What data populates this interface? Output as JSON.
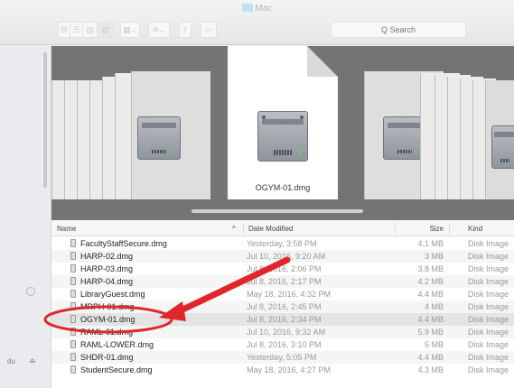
{
  "window": {
    "title": "Mac"
  },
  "toolbar": {
    "search_placeholder": "Q Search",
    "view_buttons": [
      "icon-view-icon",
      "list-view-icon",
      "column-view-icon",
      "coverflow-view-icon"
    ],
    "arrange_icon": "arrange-icon",
    "action_icon": "gear-icon",
    "share_icon": "share-icon",
    "tag_icon": "tag-icon"
  },
  "sidebar": {
    "partial_text": "du"
  },
  "coverflow": {
    "selected_label": "OGYM-01.dmg"
  },
  "columns": {
    "name": "Name",
    "date": "Date Modified",
    "size": "Size",
    "kind": "Kind",
    "sort_indicator": "^"
  },
  "files": [
    {
      "name": "FacultyStaffSecure.dmg",
      "date": "Yesterday, 3:58 PM",
      "size": "4.1 MB",
      "kind": "Disk Image"
    },
    {
      "name": "HARP-02.dmg",
      "date": "Jul 10, 2016, 9:20 AM",
      "size": "3 MB",
      "kind": "Disk Image"
    },
    {
      "name": "HARP-03.dmg",
      "date": "Jul 8, 2016, 2:06 PM",
      "size": "3.8 MB",
      "kind": "Disk Image"
    },
    {
      "name": "HARP-04.dmg",
      "date": "Jul 8, 2016, 2:17 PM",
      "size": "4.2 MB",
      "kind": "Disk Image"
    },
    {
      "name": "LibraryGuest.dmg",
      "date": "May 18, 2016, 4:32 PM",
      "size": "4.4 MB",
      "kind": "Disk Image"
    },
    {
      "name": "MRPH-01.dmg",
      "date": "Jul 8, 2016, 2:45 PM",
      "size": "4 MB",
      "kind": "Disk Image"
    },
    {
      "name": "OGYM-01.dmg",
      "date": "Jul 8, 2016, 2:34 PM",
      "size": "4.4 MB",
      "kind": "Disk Image",
      "selected": true
    },
    {
      "name": "RAML-01.dmg",
      "date": "Jul 10, 2016, 9:32 AM",
      "size": "5.9 MB",
      "kind": "Disk Image"
    },
    {
      "name": "RAML-LOWER.dmg",
      "date": "Jul 8, 2016, 3:10 PM",
      "size": "5 MB",
      "kind": "Disk Image"
    },
    {
      "name": "SHDR-01.dmg",
      "date": "Yesterday, 5:05 PM",
      "size": "4.4 MB",
      "kind": "Disk Image"
    },
    {
      "name": "StudentSecure.dmg",
      "date": "May 18, 2016, 4:27 PM",
      "size": "4.3 MB",
      "kind": "Disk Image"
    }
  ],
  "annotation": {
    "arrow_color": "#e0262b",
    "circle_color": "#e0262b"
  }
}
